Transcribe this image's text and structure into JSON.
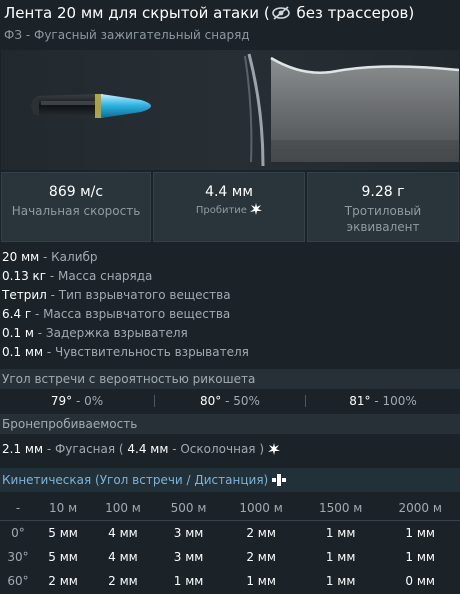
{
  "header": {
    "title_prefix": "Лента 20 мм для скрытой атаки (",
    "title_suffix": " без трассеров)",
    "subtitle": "ФЗ - Фугасный зажигательный снаряд"
  },
  "stats": [
    {
      "value": "869 м/с",
      "label": "Начальная скорость"
    },
    {
      "value": "4.4 мм",
      "label": "Пробитие"
    },
    {
      "value": "9.28 г",
      "label": "Тротиловый эквивалент"
    }
  ],
  "props": [
    {
      "value": "20 мм",
      "label": " - Калибр"
    },
    {
      "value": "0.13 кг",
      "label": " - Масса снаряда"
    },
    {
      "value": "Тетрил",
      "label": " - Тип взрывчатого вещества"
    },
    {
      "value": "6.4 г",
      "label": " - Масса взрывчатого вещества"
    },
    {
      "value": "0.1 м",
      "label": " - Задержка взрывателя"
    },
    {
      "value": "0.1 мм",
      "label": " - Чувствительность взрывателя"
    }
  ],
  "ricochet": {
    "header": "Угол встречи с вероятностью рикошета",
    "cells": [
      {
        "value": "79°",
        "label": " - 0%"
      },
      {
        "value": "80°",
        "label": " - 50%"
      },
      {
        "value": "81°",
        "label": " - 100%"
      }
    ]
  },
  "penetration": {
    "header": "Бронепробиваемость",
    "he_value": "2.1 мм",
    "he_label": " - Фугасная ( ",
    "frag_value": "4.4 мм",
    "frag_label": " - Осколочная ) "
  },
  "kinetic": {
    "header": "Кинетическая (Угол встречи / Дистанция)",
    "corner": "-",
    "distances": [
      "10 м",
      "100 м",
      "500 м",
      "1000 м",
      "1500 м",
      "2000 м"
    ],
    "rows": [
      {
        "angle": "0°",
        "values": [
          "5 мм",
          "4 мм",
          "3 мм",
          "2 мм",
          "1 мм",
          "1 мм"
        ]
      },
      {
        "angle": "30°",
        "values": [
          "5 мм",
          "4 мм",
          "3 мм",
          "2 мм",
          "1 мм",
          "1 мм"
        ]
      },
      {
        "angle": "60°",
        "values": [
          "2 мм",
          "2 мм",
          "1 мм",
          "1 мм",
          "1 мм",
          "0 мм"
        ]
      }
    ]
  },
  "icons": {
    "no_tracer": "eye-slash-icon",
    "shatter": "burst-icon",
    "kinetic": "shell-fragment-icon"
  }
}
